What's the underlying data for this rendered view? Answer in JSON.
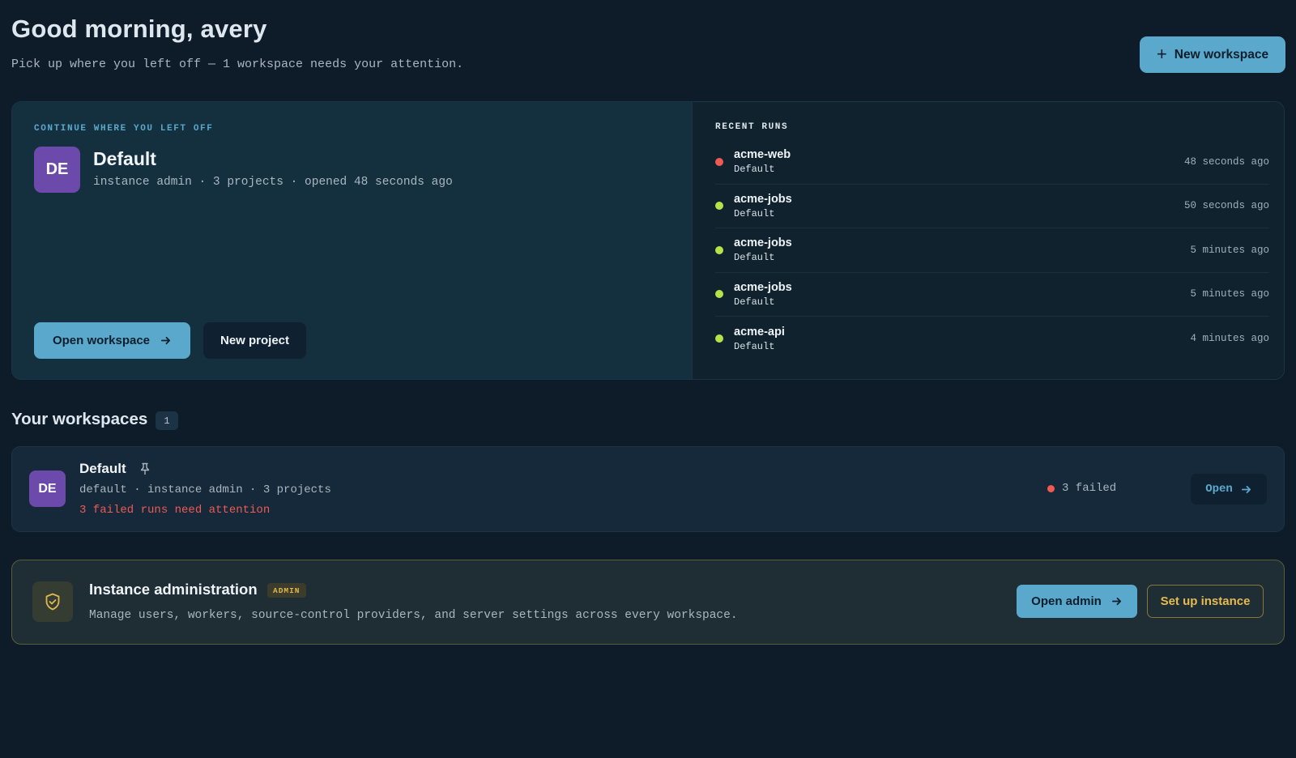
{
  "header": {
    "greeting": "Good morning, avery",
    "subtitle": "Pick up where you left off — 1 workspace needs your attention.",
    "new_workspace_label": "New workspace"
  },
  "continue": {
    "eyebrow": "CONTINUE WHERE YOU LEFT OFF",
    "avatar_initials": "DE",
    "workspace_name": "Default",
    "meta": "instance admin · 3 projects · opened 48 seconds ago",
    "open_workspace_label": "Open workspace",
    "new_project_label": "New project"
  },
  "recent_runs": {
    "title": "RECENT RUNS",
    "runs": [
      {
        "name": "acme-web",
        "workspace": "Default",
        "time": "48 seconds ago",
        "status": "failed",
        "color": "#ef5a52"
      },
      {
        "name": "acme-jobs",
        "workspace": "Default",
        "time": "50 seconds ago",
        "status": "success",
        "color": "#b6e34a"
      },
      {
        "name": "acme-jobs",
        "workspace": "Default",
        "time": "5 minutes ago",
        "status": "success",
        "color": "#b6e34a"
      },
      {
        "name": "acme-jobs",
        "workspace": "Default",
        "time": "5 minutes ago",
        "status": "success",
        "color": "#b6e34a"
      },
      {
        "name": "acme-api",
        "workspace": "Default",
        "time": "4 minutes ago",
        "status": "success",
        "color": "#b6e34a"
      }
    ]
  },
  "workspaces": {
    "title": "Your workspaces",
    "count": "1",
    "items": [
      {
        "avatar_initials": "DE",
        "name": "Default",
        "meta": "default · instance admin · 3 projects",
        "alert": "3 failed runs need attention",
        "status": "3 failed",
        "open_label": "Open",
        "pin_icon": "pin-icon"
      }
    ]
  },
  "admin": {
    "title": "Instance administration",
    "badge": "ADMIN",
    "description": "Manage users, workers, source-control providers, and server settings across every workspace.",
    "open_admin_label": "Open admin",
    "setup_label": "Set up instance",
    "icon": "shield-check-icon"
  },
  "colors": {
    "background": "#0e1c2a",
    "accent": "#5aa9cc",
    "avatar": "#6c4aac",
    "danger": "#ef5a52",
    "success": "#b6e34a",
    "admin_gold": "#e6bb50"
  }
}
